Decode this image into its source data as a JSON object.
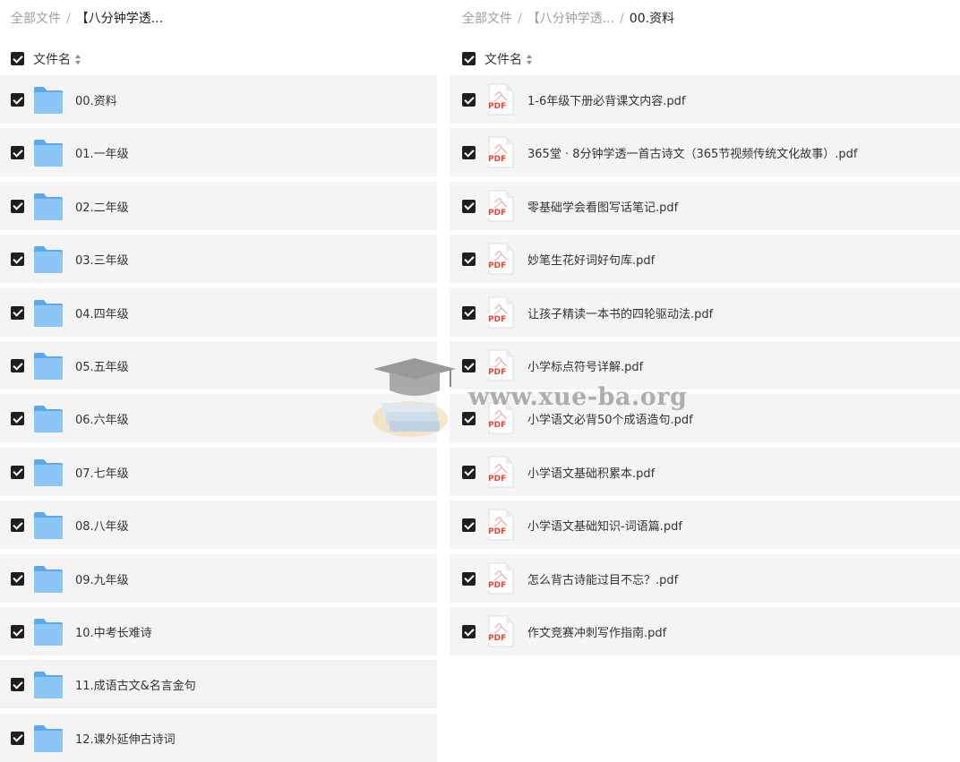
{
  "left_pane": {
    "breadcrumb": {
      "root": "全部文件",
      "sep": "/",
      "current": "【八分钟学透..."
    },
    "header_label": "文件名",
    "rows": [
      "00.资料",
      "01.一年级",
      "02.二年级",
      "03.三年级",
      "04.四年级",
      "05.五年级",
      "06.六年级",
      "07.七年级",
      "08.八年级",
      "09.九年级",
      "10.中考长难诗",
      "11.成语古文&名言金句",
      "12.课外延伸古诗词"
    ]
  },
  "right_pane": {
    "breadcrumb": {
      "root": "全部文件",
      "sep": "/",
      "mid": "【八分钟学透...",
      "sep2": "/",
      "current": "00.资料"
    },
    "header_label": "文件名",
    "rows": [
      "1-6年级下册必背课文内容.pdf",
      "365堂 · 8分钟学透一首古诗文（365节视频传统文化故事）.pdf",
      "零基础学会看图写话笔记.pdf",
      "妙笔生花好词好句库.pdf",
      "让孩子精读一本书的四轮驱动法.pdf",
      "小学标点符号详解.pdf",
      "小学语文必背50个成语造句.pdf",
      "小学语文基础积累本.pdf",
      "小学语文基础知识-词语篇.pdf",
      "怎么背古诗能过目不忘？.pdf",
      "作文竞赛冲刺写作指南.pdf"
    ],
    "pdf_badge": "PDF"
  },
  "watermark": {
    "text": "www.xue-ba.org"
  },
  "colors": {
    "row_bg": "#f4f4f4",
    "checkbox": "#1f1f1f",
    "folder": "#7ab8f0",
    "pdf_red": "#e0443a"
  }
}
